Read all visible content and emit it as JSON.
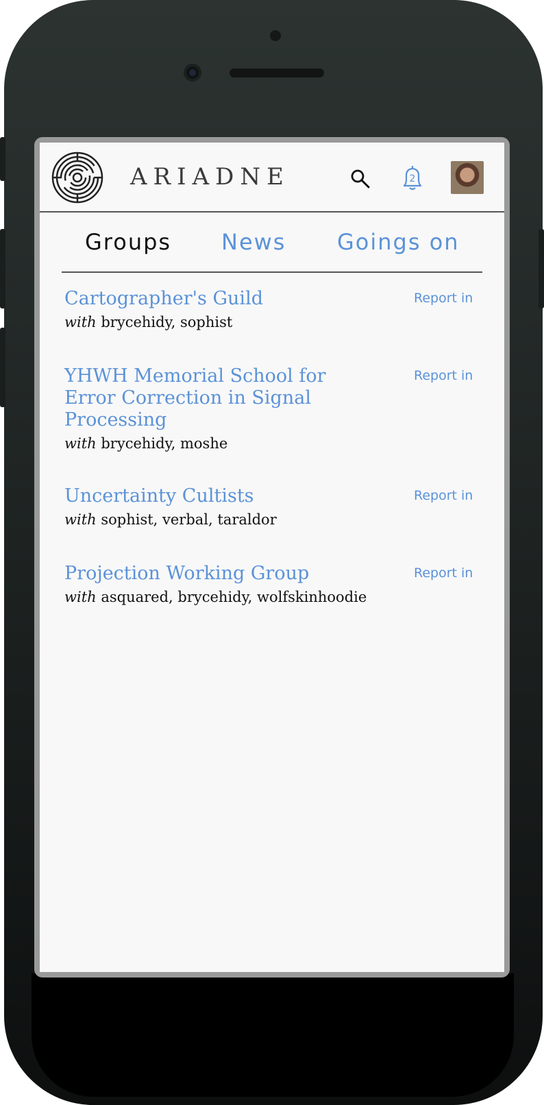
{
  "app": {
    "brand": "ARIADNE",
    "notifications_count": "2"
  },
  "tabs": [
    {
      "label": "Groups",
      "active": true
    },
    {
      "label": "News",
      "active": false
    },
    {
      "label": "Goings on",
      "active": false
    }
  ],
  "with_label": "with",
  "report_label": "Report in",
  "groups": [
    {
      "name": "Cartographer's Guild",
      "members": "brycehidy, sophist"
    },
    {
      "name": "YHWH Memorial School for Error Correction in Signal Processing",
      "members": "brycehidy, moshe"
    },
    {
      "name": "Uncertainty Cultists",
      "members": "sophist, verbal, taraldor"
    },
    {
      "name": "Projection Working Group",
      "members": "asquared, brycehidy, wolfskinhoodie"
    }
  ],
  "colors": {
    "accent": "#5b92d8",
    "phone_body": "#1c2120",
    "screen_bg": "#f8f8f8"
  },
  "icons": [
    "labyrinth-logo-icon",
    "search-icon",
    "bell-icon",
    "avatar"
  ]
}
